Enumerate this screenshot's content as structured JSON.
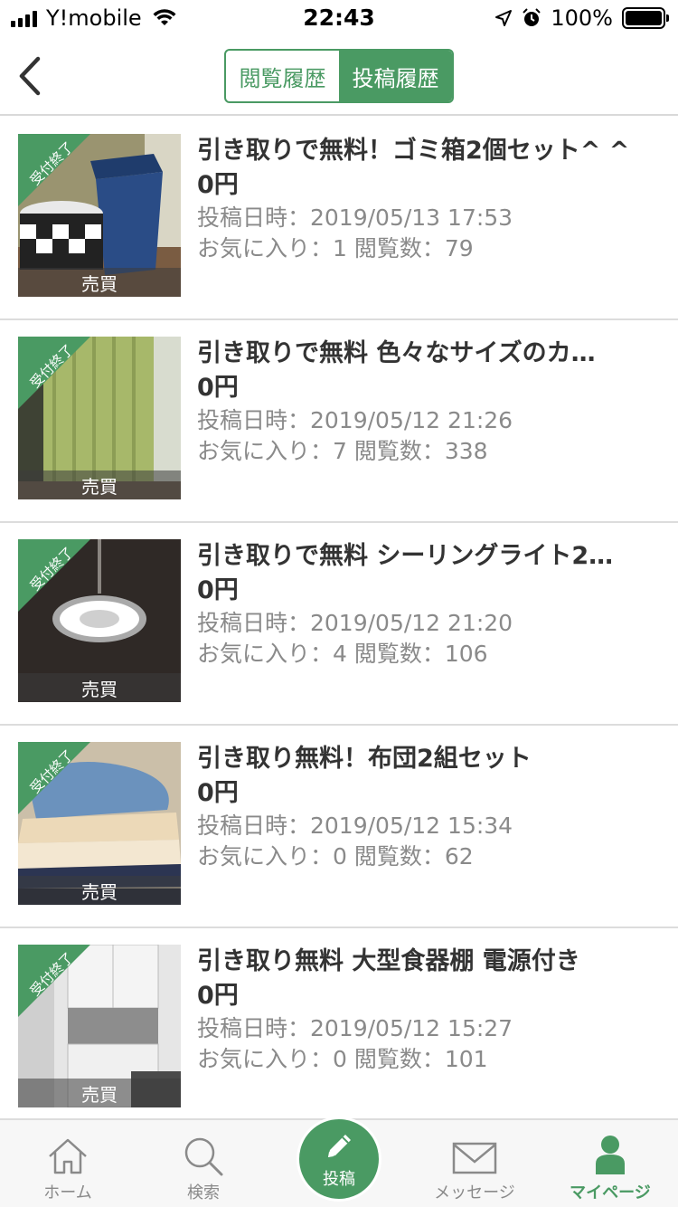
{
  "status_bar": {
    "carrier": "Y!mobile",
    "time": "22:43",
    "battery": "100%"
  },
  "header": {
    "segments": [
      {
        "label": "閲覧履歴",
        "active": false
      },
      {
        "label": "投稿履歴",
        "active": true
      }
    ]
  },
  "items": [
    {
      "ribbon": "受付終了",
      "type": "売買",
      "title": "引き取りで無料！ゴミ箱2個セット^ ^",
      "price": "0円",
      "posted": "投稿日時：2019/05/13 17:53",
      "stats": "お気に入り：1 閲覧数：79"
    },
    {
      "ribbon": "受付終了",
      "type": "売買",
      "title": "引き取りで無料 色々なサイズのカ…",
      "price": "0円",
      "posted": "投稿日時：2019/05/12 21:26",
      "stats": "お気に入り：7 閲覧数：338"
    },
    {
      "ribbon": "受付終了",
      "type": "売買",
      "title": "引き取りで無料 シーリングライト2…",
      "price": "0円",
      "posted": "投稿日時：2019/05/12 21:20",
      "stats": "お気に入り：4 閲覧数：106"
    },
    {
      "ribbon": "受付終了",
      "type": "売買",
      "title": "引き取り無料！布団2組セット",
      "price": "0円",
      "posted": "投稿日時：2019/05/12 15:34",
      "stats": "お気に入り：0 閲覧数：62"
    },
    {
      "ribbon": "受付終了",
      "type": "売買",
      "title": "引き取り無料 大型食器棚 電源付き",
      "price": "0円",
      "posted": "投稿日時：2019/05/12 15:27",
      "stats": "お気に入り：0 閲覧数：101"
    }
  ],
  "tabbar": {
    "home": "ホーム",
    "search": "検索",
    "post": "投稿",
    "messages": "メッセージ",
    "mypage": "マイページ"
  },
  "colors": {
    "accent": "#4a9a63"
  }
}
